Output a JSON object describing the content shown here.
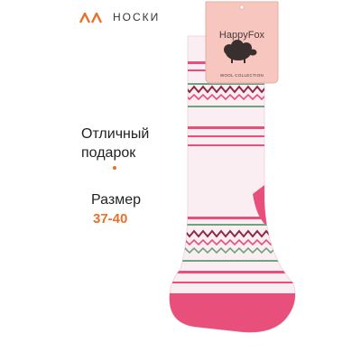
{
  "brand": {
    "logo_color": "#e8702a"
  },
  "category": "НОСКИ",
  "promo": {
    "headline_line1": "Отличный",
    "headline_line2": "подарок",
    "size_label": "Размер",
    "size_value": "37-40",
    "accent_color": "#e8702a"
  },
  "product": {
    "tag_brand": "HappyFox",
    "tag_subtitle": "WOOL COLLECTION",
    "tag_color": "#f6c6bf",
    "sock_base_color": "#fbeef2",
    "accent_pink": "#e94f7b",
    "pattern_green": "#6fa37f",
    "pattern_maroon": "#8b2a45"
  }
}
